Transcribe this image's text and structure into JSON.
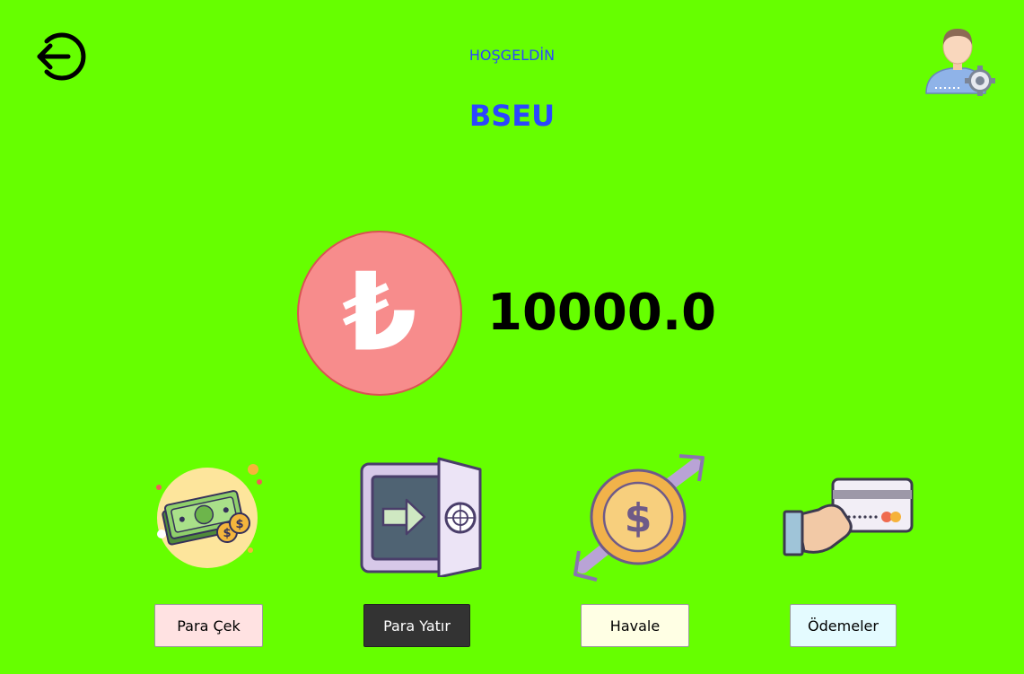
{
  "header": {
    "welcome_text": "HOŞGELDİN",
    "username": "BSEU"
  },
  "balance": {
    "currency_symbol": "₺",
    "amount": "10000.0"
  },
  "actions": [
    {
      "label": "Para Çek",
      "icon": "cash-icon"
    },
    {
      "label": "Para Yatır",
      "icon": "safe-icon"
    },
    {
      "label": "Havale",
      "icon": "transfer-icon"
    },
    {
      "label": "Ödemeler",
      "icon": "card-payment-icon"
    }
  ],
  "toolbar": {
    "logout_icon": "logout-icon",
    "settings_icon": "user-settings-icon"
  },
  "colors": {
    "background": "#66ff00",
    "accent_text": "#2b46ff",
    "lira_circle": "#f78c8c"
  }
}
